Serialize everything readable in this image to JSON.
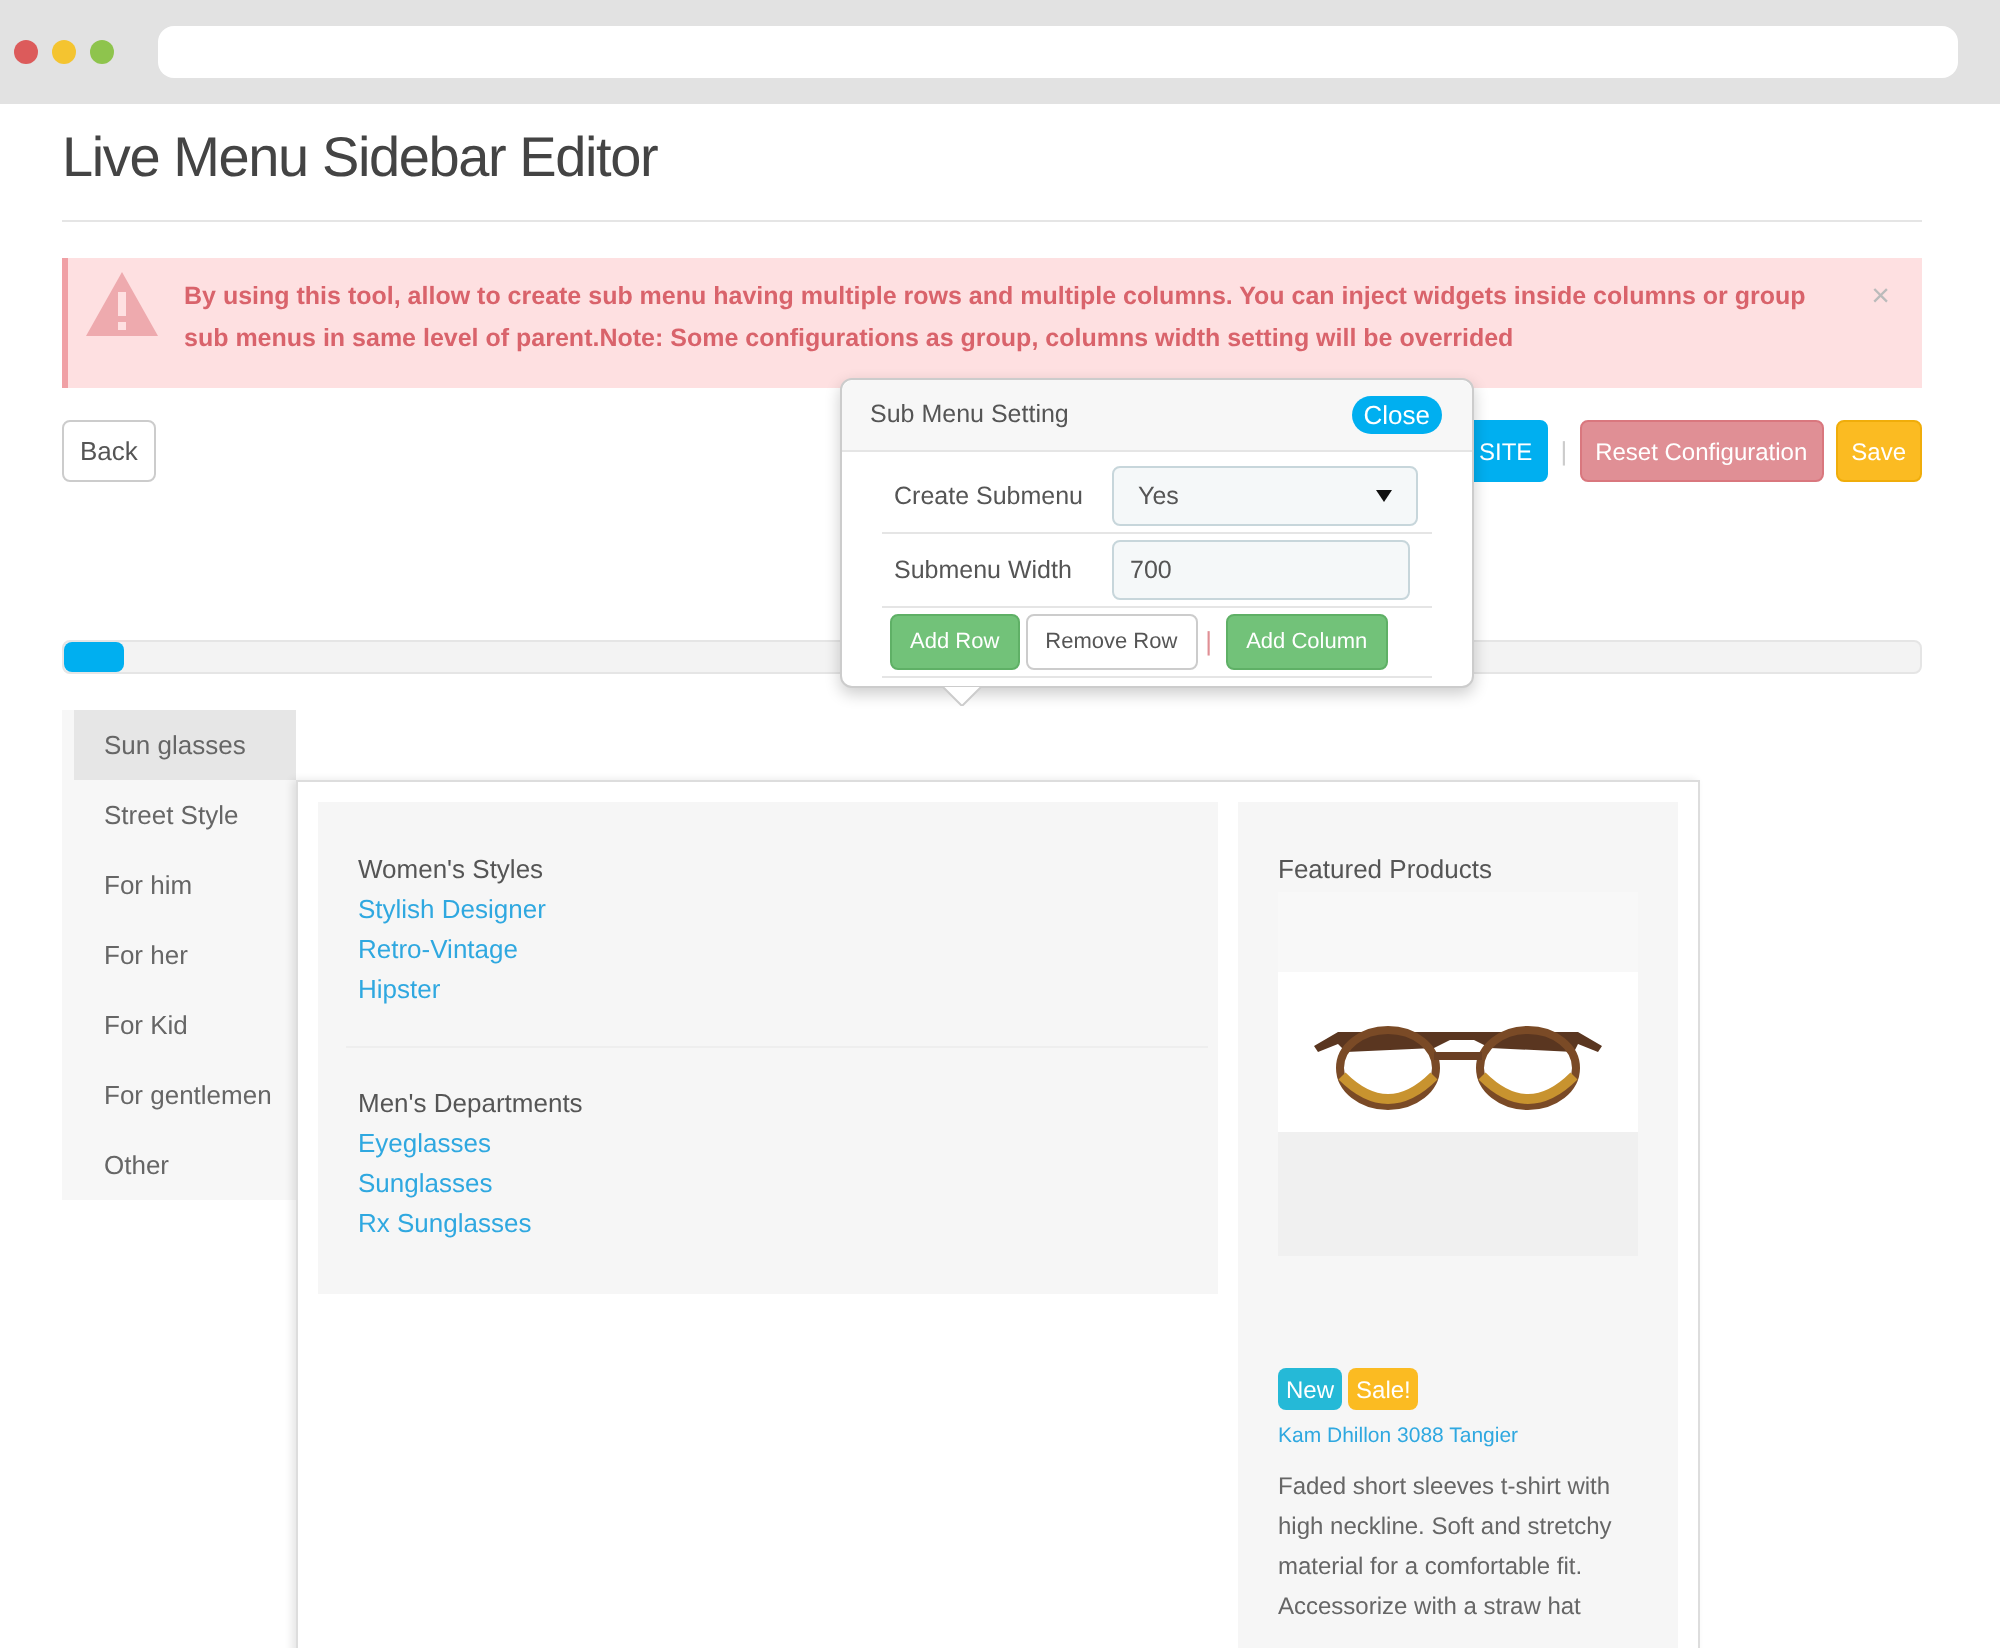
{
  "page": {
    "title": "Live Menu Sidebar Editor"
  },
  "alert": {
    "text": "By using this tool, allow to create sub menu having multiple rows and multiple columns. You can inject widgets inside columns or group sub menus in same level of parent.Note: Some configurations as group, columns width setting will be overrided",
    "close": "×"
  },
  "toolbar": {
    "back": "Back",
    "buttons": [
      {
        "label": "SITE",
        "kind": "info"
      },
      {
        "label": "Reset Configuration",
        "kind": "danger"
      },
      {
        "label": "Save",
        "kind": "warning"
      }
    ],
    "separator": "|"
  },
  "progress": {
    "level": 0.032
  },
  "sidebar": {
    "items": [
      {
        "label": "Sun glasses",
        "selected": true
      },
      {
        "label": "Street Style",
        "selected": false
      },
      {
        "label": "For him",
        "selected": false
      },
      {
        "label": "For her",
        "selected": false
      },
      {
        "label": "For Kid",
        "selected": false
      },
      {
        "label": "For gentlemen",
        "selected": false
      },
      {
        "label": "Other",
        "selected": false
      }
    ]
  },
  "submenu": {
    "groups": [
      {
        "title": "Women's Styles",
        "links": [
          "Stylish Designer",
          "Retro-Vintage",
          "Hipster"
        ]
      },
      {
        "title": "Men's Departments",
        "links": [
          "Eyeglasses",
          "Sunglasses",
          "Rx Sunglasses"
        ]
      }
    ],
    "featured": {
      "title": "Featured Products",
      "badges": [
        {
          "label": "New",
          "color": "#25b9d7"
        },
        {
          "label": "Sale!",
          "color": "#fbbb22"
        }
      ],
      "product": "Kam Dhillon 3088 Tangier",
      "description": "Faded short sleeves t-shirt with high neckline. Soft and stretchy material for a comfortable fit. Accessorize with a straw hat"
    }
  },
  "popover": {
    "title": "Sub Menu Setting",
    "close": "Close",
    "create_label": "Create Submenu",
    "create_value": "Yes",
    "width_label": "Submenu Width",
    "width_value": "700",
    "buttons": [
      {
        "label": "Add Row",
        "kind": "success"
      },
      {
        "label": "Remove Row",
        "kind": "default"
      },
      {
        "label": "Add Column",
        "kind": "success"
      }
    ],
    "separator": "|"
  }
}
